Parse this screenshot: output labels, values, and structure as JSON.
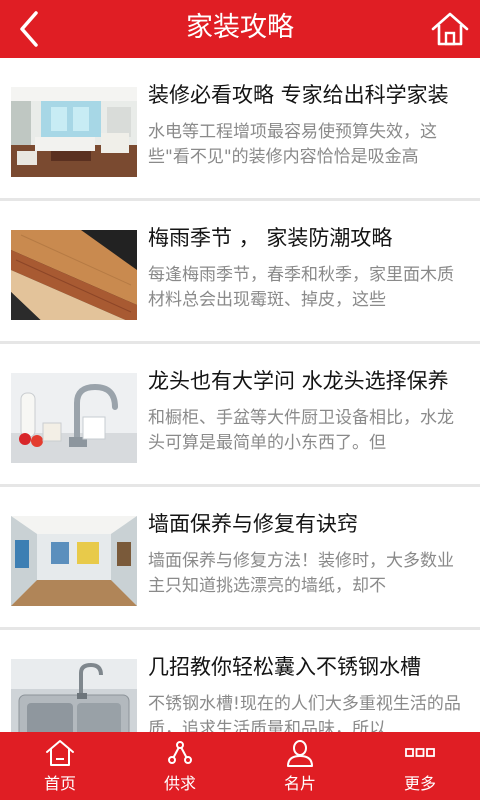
{
  "header": {
    "title": "家装攻略",
    "back_icon": "back-chevron-icon",
    "home_icon": "home-icon"
  },
  "articles": [
    {
      "title": "装修必看攻略 专家给出科学家装",
      "summary": "水电等工程增项最容易使预算失效，这些\"看不见\"的装修内容恰恰是吸金高",
      "thumbnail": "living-room-photo"
    },
    {
      "title": "梅雨季节 ， 家装防潮攻略",
      "summary": "每逢梅雨季节，春季和秋季，家里面木质材料总会出现霉斑、掉皮，这些",
      "thumbnail": "wood-boards-photo"
    },
    {
      "title": "龙头也有大学问 水龙头选择保养",
      "summary": "和橱柜、手盆等大件厨卫设备相比，水龙头可算是最简单的小东西了。但",
      "thumbnail": "faucet-photo"
    },
    {
      "title": "墙面保养与修复有诀窍",
      "summary": "墙面保养与修复方法！装修时，大多数业主只知道挑选漂亮的墙纸，却不",
      "thumbnail": "room-interior-photo"
    },
    {
      "title": "几招教你轻松囊入不锈钢水槽",
      "summary": "不锈钢水槽!现在的人们大多重视生活的品质，追求生活质量和品味，所以",
      "thumbnail": "steel-sink-photo"
    }
  ],
  "tabbar": [
    {
      "label": "首页",
      "icon": "home-outline-icon"
    },
    {
      "label": "供求",
      "icon": "share-nodes-icon"
    },
    {
      "label": "名片",
      "icon": "user-icon"
    },
    {
      "label": "更多",
      "icon": "more-squares-icon"
    }
  ],
  "colors": {
    "brand_red": "#e01e24",
    "title_text": "#141414",
    "summary_text": "#8a8a8a",
    "divider": "#e6e6e6"
  }
}
